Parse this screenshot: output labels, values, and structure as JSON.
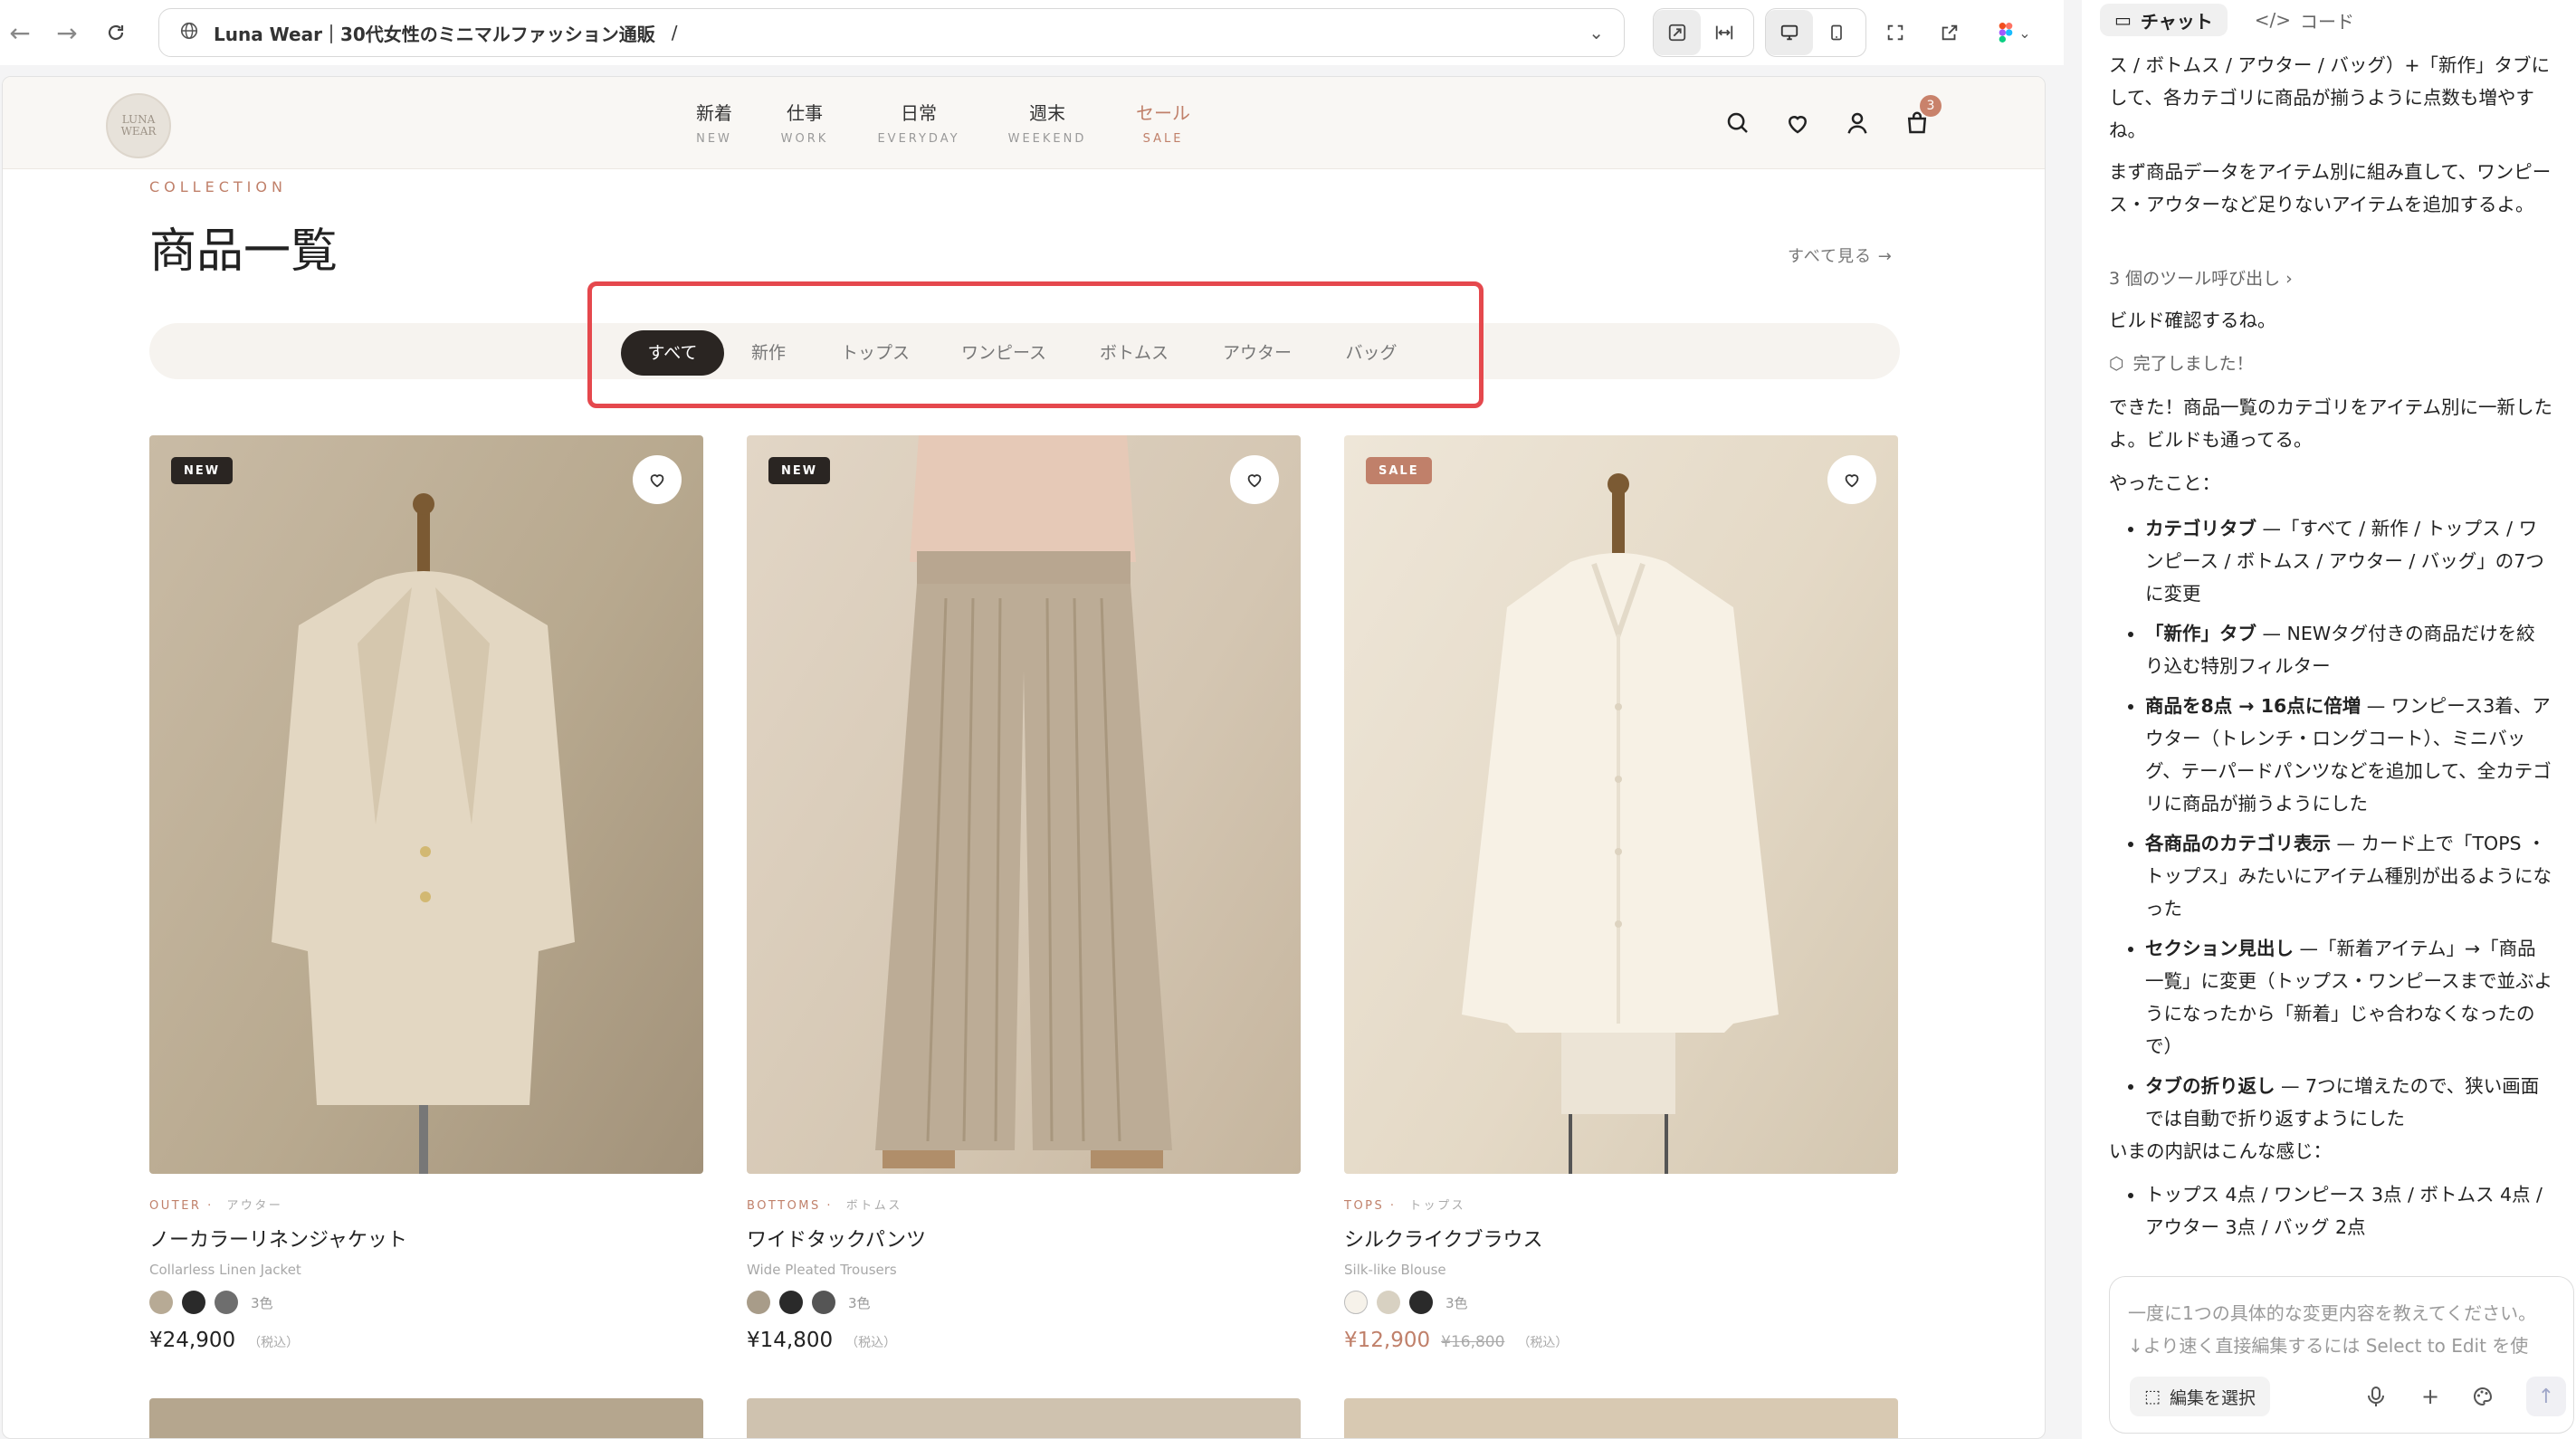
{
  "browser": {
    "site_name": "Luna Wear｜30代女性のミニマルファッション通販",
    "path": "/"
  },
  "site": {
    "logo_text": "LUNA\nWEAR",
    "nav": [
      {
        "jp": "新着",
        "en": "NEW"
      },
      {
        "jp": "仕事",
        "en": "WORK"
      },
      {
        "jp": "日常",
        "en": "EVERYDAY"
      },
      {
        "jp": "週末",
        "en": "WEEKEND"
      },
      {
        "jp": "セール",
        "en": "SALE"
      }
    ],
    "cart_count": "3",
    "colors": {
      "accent": "#c0806a",
      "dark": "#2a2522",
      "highlight": "#e5484d"
    }
  },
  "section": {
    "eyebrow": "COLLECTION",
    "title": "商品一覧",
    "see_all": "すべて見る →"
  },
  "tabs": {
    "active": "すべて",
    "items": [
      "すべて",
      "新作",
      "トップス",
      "ワンピース",
      "ボトムス",
      "アウター",
      "バッグ"
    ]
  },
  "products": [
    {
      "badge": "NEW",
      "cat_en": "OUTER",
      "cat_jp": "アウター",
      "name": "ノーカラーリネンジャケット",
      "name_en": "Collarless Linen Jacket",
      "colors_count": "3色",
      "price": "¥24,900",
      "tax": "（税込）",
      "swatches": [
        "#b7aa95",
        "#2a2a2a",
        "#6e6e6e"
      ]
    },
    {
      "badge": "NEW",
      "cat_en": "BOTTOMS",
      "cat_jp": "ボトムス",
      "name": "ワイドタックパンツ",
      "name_en": "Wide Pleated Trousers",
      "colors_count": "3色",
      "price": "¥14,800",
      "tax": "（税込）",
      "swatches": [
        "#a89c89",
        "#2a2a2a",
        "#555555"
      ]
    },
    {
      "badge": "SALE",
      "cat_en": "TOPS",
      "cat_jp": "トップス",
      "name": "シルクライクブラウス",
      "name_en": "Silk-like Blouse",
      "colors_count": "3色",
      "price": "¥12,900",
      "orig_price": "¥16,800",
      "tax": "（税込）",
      "swatches": [
        "#f6f2ea",
        "#d8d1c2",
        "#2a2a2a"
      ]
    }
  ],
  "chat": {
    "tabs": [
      "チャット",
      "コード"
    ],
    "intro": "ス / ボトムス / アウター / バッグ）+「新作」タブにして、各カテゴリに商品が揃うように点数も増やすね。",
    "plan": "まず商品データをアイテム別に組み直して、ワンピース・アウターなど足りないアイテムを追加するよ。",
    "tool_calls": "3 個のツール呼び出し ›",
    "build_check": "ビルド確認するね。",
    "done": "完了しました！",
    "result": "できた！商品一覧のカテゴリをアイテム別に一新したよ。ビルドも通ってる。",
    "did_label": "やったこと：",
    "bullets": [
      {
        "b": "カテゴリタブ",
        "t": " —「すべて / 新作 / トップス / ワンピース / ボトムス / アウター / バッグ」の7つに変更"
      },
      {
        "b": "「新作」タブ",
        "t": " — NEWタグ付きの商品だけを絞り込む特別フィルター"
      },
      {
        "b": "商品を8点 → 16点に倍増",
        "t": " — ワンピース3着、アウター（トレンチ・ロングコート）、ミニバッグ、テーパードパンツなどを追加して、全カテゴリに商品が揃うようにした"
      },
      {
        "b": "各商品のカテゴリ表示",
        "t": " — カード上で「TOPS ・ トップス」みたいにアイテム種別が出るようになった"
      },
      {
        "b": "セクション見出し",
        "t": " —「新着アイテム」→「商品一覧」に変更（トップス・ワンピースまで並ぶようになったから「新着」じゃ合わなくなったので）"
      },
      {
        "b": "タブの折り返し",
        "t": " — 7つに増えたので、狭い画面では自動で折り返すようにした"
      }
    ],
    "breakdown_label": "いまの内訳はこんな感じ：",
    "breakdown": "トップス 4点 / ワンピース 3点 / ボトムス 4点 / アウター 3点 / バッグ 2点",
    "composer_placeholder": "一度に1つの具体的な変更内容を教えてください。\n↓より速く直接編集するには Select to Edit を使",
    "select_button": "編集を選択"
  }
}
